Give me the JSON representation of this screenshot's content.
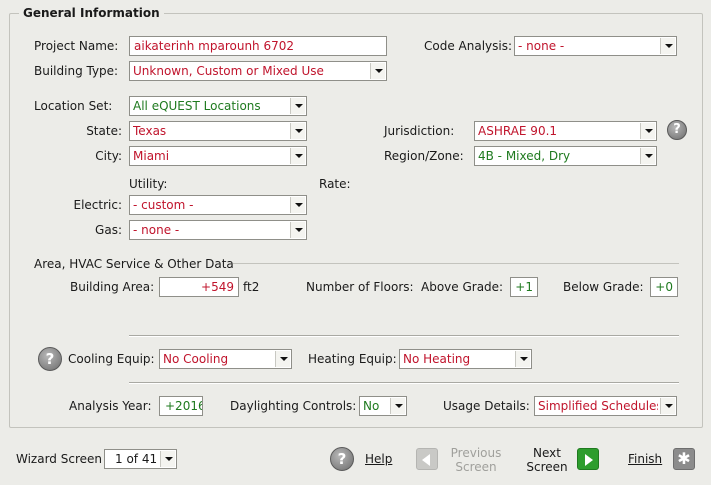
{
  "group": {
    "title": "General Information"
  },
  "project": {
    "name_label": "Project Name:",
    "name_value": "aikaterinh mparounh 6702",
    "code_analysis_label": "Code Analysis:",
    "code_analysis_value": "- none -",
    "building_type_label": "Building Type:",
    "building_type_value": "Unknown, Custom or Mixed Use"
  },
  "location": {
    "set_label": "Location Set:",
    "set_value": "All eQUEST Locations",
    "state_label": "State:",
    "state_value": "Texas",
    "city_label": "City:",
    "city_value": "Miami",
    "jurisdiction_label": "Jurisdiction:",
    "jurisdiction_value": "ASHRAE 90.1",
    "region_label": "Region/Zone:",
    "region_value": "4B - Mixed, Dry"
  },
  "utility": {
    "utility_label": "Utility:",
    "rate_label": "Rate:",
    "electric_label": "Electric:",
    "electric_value": "- custom -",
    "gas_label": "Gas:",
    "gas_value": "- none -"
  },
  "area": {
    "section_title": "Area, HVAC Service & Other Data",
    "building_area_label": "Building Area:",
    "building_area_value": "+549",
    "building_area_unit": "ft2",
    "floors_label": "Number of Floors:",
    "above_grade_label": "Above Grade:",
    "above_grade_value": "+1",
    "below_grade_label": "Below Grade:",
    "below_grade_value": "+0"
  },
  "hvac": {
    "cooling_label": "Cooling Equip:",
    "cooling_value": "No Cooling",
    "heating_label": "Heating Equip:",
    "heating_value": "No Heating"
  },
  "analysis": {
    "year_label": "Analysis Year:",
    "year_value": "+2016",
    "daylighting_label": "Daylighting Controls:",
    "daylighting_value": "No",
    "usage_label": "Usage Details:",
    "usage_value": "Simplified Schedules"
  },
  "footer": {
    "wizard_label": "Wizard Screen",
    "wizard_value": "1 of 41",
    "help_label": "Help",
    "prev_line1": "Previous",
    "prev_line2": "Screen",
    "next_line1": "Next",
    "next_line2": "Screen",
    "finish_label": "Finish"
  },
  "icons": {
    "help": "help-question-icon",
    "prev": "arrow-left-icon",
    "next": "arrow-right-icon",
    "finish": "finish-icon",
    "dropdown": "chevron-down-icon"
  },
  "colors": {
    "background": "#ecece8",
    "value_red": "#c0142c",
    "value_green": "#1f7a1f",
    "next_green": "#2d9d2d"
  }
}
